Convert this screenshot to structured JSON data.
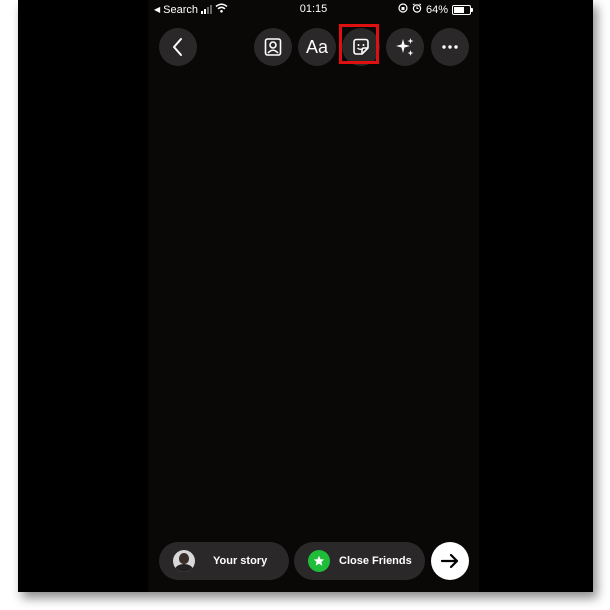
{
  "status_bar": {
    "back_app": "Search",
    "time": "01:15",
    "battery": "64%",
    "battery_level": 0.64
  },
  "toolbar": {
    "text_tool_label": "Aa"
  },
  "bottom_bar": {
    "your_story_label": "Your story",
    "close_friends_label": "Close Friends"
  },
  "colors": {
    "canvas": "#0a0707",
    "button_bg": "#2a2828",
    "highlight": "#e01010",
    "close_friends_badge": "#1fbd3a"
  },
  "icons": {
    "back": "chevron-left-icon",
    "tag": "person-tag-icon",
    "sticker": "sticker-icon",
    "effects": "sparkles-icon",
    "more": "more-horizontal-icon",
    "close_friends": "star-icon",
    "send": "arrow-right-icon"
  }
}
